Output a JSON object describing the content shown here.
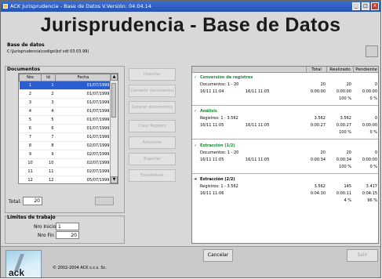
{
  "window": {
    "title": "ACK Jurisprudencia - Base de Datos V.Versión: 04.04.14",
    "heading": "Jurisprudencia - Base de Datos"
  },
  "database": {
    "label": "Base de datos",
    "path": "C:\\Jurisprudencia\\codigo\\bd vdt 03.03.99)"
  },
  "documents": {
    "label": "Documentos",
    "columns": [
      "Nro",
      "Id",
      "Fecha"
    ],
    "rows": [
      {
        "nro": "1",
        "id": "1",
        "fecha": "01/07/1999"
      },
      {
        "nro": "2",
        "id": "2",
        "fecha": "01/07/1999"
      },
      {
        "nro": "3",
        "id": "3",
        "fecha": "01/07/1999"
      },
      {
        "nro": "4",
        "id": "4",
        "fecha": "01/07/1999"
      },
      {
        "nro": "5",
        "id": "5",
        "fecha": "01/07/1999"
      },
      {
        "nro": "6",
        "id": "6",
        "fecha": "01/07/1999"
      },
      {
        "nro": "7",
        "id": "7",
        "fecha": "01/07/1999"
      },
      {
        "nro": "8",
        "id": "8",
        "fecha": "02/07/1999"
      },
      {
        "nro": "9",
        "id": "9",
        "fecha": "02/07/1999"
      },
      {
        "nro": "10",
        "id": "10",
        "fecha": "02/07/1999"
      },
      {
        "nro": "11",
        "id": "11",
        "fecha": "02/07/1999"
      },
      {
        "nro": "12",
        "id": "12",
        "fecha": "05/07/1999"
      }
    ],
    "total_label": "Total:",
    "total_value": "20"
  },
  "limits": {
    "label": "Límites de trabajo",
    "start_label": "Nro Inicio",
    "start_value": "1",
    "end_label": "Nro Fin",
    "end_value": "20"
  },
  "actions": [
    "Importar",
    "Convertir documentos",
    "Generar documentos",
    "Crear Registro",
    "Actualizar",
    "Exportar",
    "Estadísticas"
  ],
  "results": {
    "columns": [
      "Total",
      "Realizado",
      "Pendiente"
    ],
    "groups": [
      {
        "marker": "✓",
        "title": "Conversión de registros",
        "rows": [
          {
            "label": "Documentos: 1 - 20",
            "total": "20",
            "realizado": "20",
            "pendiente": "0"
          },
          {
            "label": "16/11 11:04",
            "label2": "16/11 11:05",
            "total": "0:00:00",
            "realizado": "0:00:00",
            "pendiente": "0:00:00"
          },
          {
            "label": "",
            "total": "",
            "realizado": "100 %",
            "pendiente": "0 %"
          }
        ]
      },
      {
        "marker": "✓",
        "title": "Análisis",
        "rows": [
          {
            "label": "Registros: 1 - 3.562",
            "total": "3.562",
            "realizado": "3.562",
            "pendiente": "0"
          },
          {
            "label": "16/11 11:05",
            "label2": "16/11 11:05",
            "total": "0:00:27",
            "realizado": "0:00:27",
            "pendiente": "0:00:00"
          },
          {
            "label": "",
            "total": "",
            "realizado": "100 %",
            "pendiente": "0 %"
          }
        ]
      },
      {
        "marker": "✓",
        "title": "Extracción (1/2)",
        "rows": [
          {
            "label": "Documentos: 1 - 20",
            "total": "20",
            "realizado": "20",
            "pendiente": "0"
          },
          {
            "label": "16/11 11:05",
            "label2": "16/11 11:05",
            "total": "0:00:34",
            "realizado": "0:00:34",
            "pendiente": "0:00:00"
          },
          {
            "label": "",
            "total": "",
            "realizado": "100 %",
            "pendiente": "0 %"
          }
        ]
      },
      {
        "marker": "➜",
        "title": "Extracción (2/2)",
        "rows": [
          {
            "label": "Registros: 1 - 3.562",
            "total": "3.562",
            "realizado": "145",
            "pendiente": "3.417"
          },
          {
            "label": "16/11 11:06",
            "total": "0:04:30",
            "realizado": "0:00:11",
            "pendiente": "0:04:15"
          },
          {
            "label": "",
            "total": "",
            "realizado": "4 %",
            "pendiente": "96 %"
          }
        ]
      }
    ]
  },
  "footer": {
    "copyright": "© 2002-2004 ACK s.c.s. Sc.",
    "logo_text": "ack",
    "cancel_label": "Cancelar",
    "exit_label": "Salir"
  }
}
